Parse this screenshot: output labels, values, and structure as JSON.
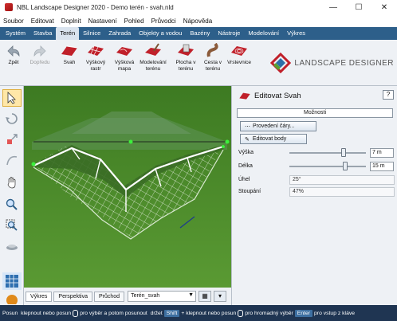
{
  "window": {
    "title": "NBL Landscape Designer 2020 - Demo terén - svah.nld",
    "minimize_icon": "minimize-icon",
    "maximize_icon": "maximize-icon",
    "close_icon": "close-icon"
  },
  "menu": [
    "Soubor",
    "Editovat",
    "Doplnit",
    "Nastavení",
    "Pohled",
    "Průvodci",
    "Nápověda"
  ],
  "tabs": [
    "Systém",
    "Stavba",
    "Terén",
    "Silnice",
    "Zahrada",
    "Objekty a vodou",
    "Bazény",
    "Nástroje",
    "Modelování",
    "Výkres"
  ],
  "active_tab": "Terén",
  "ribbon": {
    "back": "Zpět",
    "forward": "Dopředu",
    "buttons": [
      {
        "l1": "Svah",
        "l2": ""
      },
      {
        "l1": "Výškový",
        "l2": "rastr"
      },
      {
        "l1": "Výšková",
        "l2": "mapa"
      },
      {
        "l1": "Modelování",
        "l2": "terénu"
      },
      {
        "l1": "Plocha v",
        "l2": "terénu"
      },
      {
        "l1": "Cesta v",
        "l2": "terénu"
      },
      {
        "l1": "Vrstevnice",
        "l2": ""
      }
    ],
    "logo_text": "LANDSCAPE DESIGNER"
  },
  "view_tabs": {
    "tab1": "Výkres",
    "tab2": "Perspektiva",
    "tab3": "Průchod",
    "selector_value": "Terén_svah"
  },
  "panel": {
    "title": "Editovat Svah",
    "help": "?",
    "options_header": "Možnosti",
    "btn_lines": "Provedení čáry...",
    "btn_points": "Editovat body",
    "height_label": "Výška",
    "height_value": "7 m",
    "height_fraction": 0.72,
    "length_label": "Délka",
    "length_value": "15 m",
    "length_fraction": 0.74,
    "angle_label": "Úhel",
    "angle_value": "25°",
    "slope_label": "Stoupání",
    "slope_value": "47%"
  },
  "status": {
    "s1": "Posun",
    "s2": "klepnout nebo posun",
    "s3": "pro výběr a potom posunout",
    "s4": "držet",
    "k1": "Shift",
    "s5": "+ klepnout nebo posun",
    "s6": "pro hromadný výběr",
    "k2": "Enter",
    "s7": "pro vstup z kláve"
  },
  "colors": {
    "tabbar": "#2d5f8a",
    "statusbar": "#1f3552",
    "grass": "#4c8b2a",
    "accent_red": "#c0202a"
  }
}
